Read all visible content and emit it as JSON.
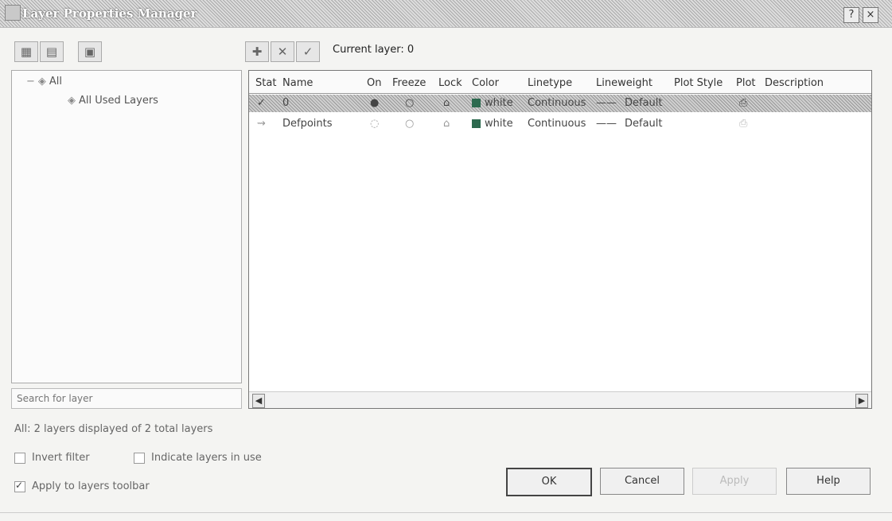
{
  "window": {
    "title": "Layer Properties Manager",
    "help_glyph": "?",
    "close_glyph": "×"
  },
  "toolbar": {
    "current_layer_label": "Current layer: 0"
  },
  "tree": {
    "items": [
      {
        "label": "All"
      },
      {
        "label": "All Used Layers"
      }
    ],
    "filter_placeholder": "Search for layer"
  },
  "layer_list": {
    "columns": [
      "Stat",
      "Name",
      "On",
      "Freeze",
      "Lock",
      "Color",
      "Linetype",
      "Lineweight",
      "Plot Style",
      "Plot",
      "Description"
    ],
    "rows": [
      {
        "name": "0",
        "color_name": "white",
        "linetype": "Continuous",
        "lineweight": "Default",
        "selected": true
      },
      {
        "name": "Defpoints",
        "color_name": "white",
        "linetype": "Continuous",
        "lineweight": "Default",
        "selected": false
      }
    ],
    "swatch_color": "#2d6a4f"
  },
  "status": {
    "text": "All: 2 layers displayed of 2 total layers"
  },
  "options": {
    "invert_filter": "Invert filter",
    "indicate_layers_in_use": "Indicate layers in use",
    "apply_to_layers_toolbar": "Apply to layers toolbar"
  },
  "buttons": {
    "ok": "OK",
    "cancel": "Cancel",
    "apply": "Apply",
    "help": "Help"
  }
}
